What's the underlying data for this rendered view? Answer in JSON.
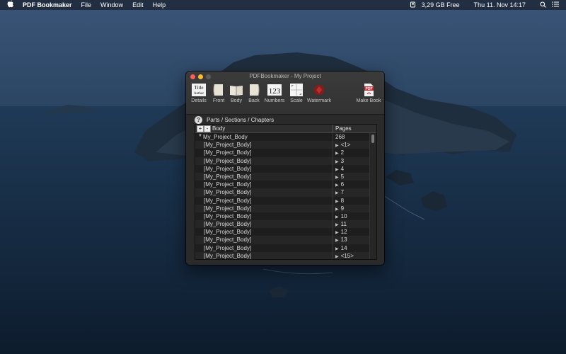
{
  "menubar": {
    "app_name": "PDF Bookmaker",
    "menus": [
      "File",
      "Window",
      "Edit",
      "Help"
    ],
    "disk_free": "3,29 GB Free",
    "clock": "Thu 11. Nov  14:17"
  },
  "window": {
    "title": "PDFBookmaker - My Project",
    "toolbar": [
      {
        "label": "Details",
        "icon": "title-author-icon"
      },
      {
        "label": "Front",
        "icon": "front-book-icon"
      },
      {
        "label": "Body",
        "icon": "open-book-icon"
      },
      {
        "label": "Back",
        "icon": "back-book-icon"
      },
      {
        "label": "Numbers",
        "icon": "numbers-icon"
      },
      {
        "label": "Scale",
        "icon": "scale-icon"
      },
      {
        "label": "Watermark",
        "icon": "watermark-icon"
      },
      {
        "label": "Make Book",
        "icon": "pdf-make-icon"
      }
    ],
    "help_label": "Parts / Sections / Chapters",
    "outline": {
      "add_label": "+",
      "remove_label": "-",
      "col_body": "Body",
      "col_pages": "Pages",
      "rows": [
        {
          "name": "My_Project_Body",
          "pages": "268"
        },
        {
          "name": "[My_Project_Body]",
          "pages": "<1>"
        },
        {
          "name": "[My_Project_Body]",
          "pages": "2"
        },
        {
          "name": "[My_Project_Body]",
          "pages": "3"
        },
        {
          "name": "[My_Project_Body]",
          "pages": "4"
        },
        {
          "name": "[My_Project_Body]",
          "pages": "5"
        },
        {
          "name": "[My_Project_Body]",
          "pages": "6"
        },
        {
          "name": "[My_Project_Body]",
          "pages": "7"
        },
        {
          "name": "[My_Project_Body]",
          "pages": "8"
        },
        {
          "name": "[My_Project_Body]",
          "pages": "9"
        },
        {
          "name": "[My_Project_Body]",
          "pages": "10"
        },
        {
          "name": "[My_Project_Body]",
          "pages": "11"
        },
        {
          "name": "[My_Project_Body]",
          "pages": "12"
        },
        {
          "name": "[My_Project_Body]",
          "pages": "13"
        },
        {
          "name": "[My_Project_Body]",
          "pages": "14"
        },
        {
          "name": "[My_Project_Body]",
          "pages": "<15>"
        }
      ]
    }
  }
}
